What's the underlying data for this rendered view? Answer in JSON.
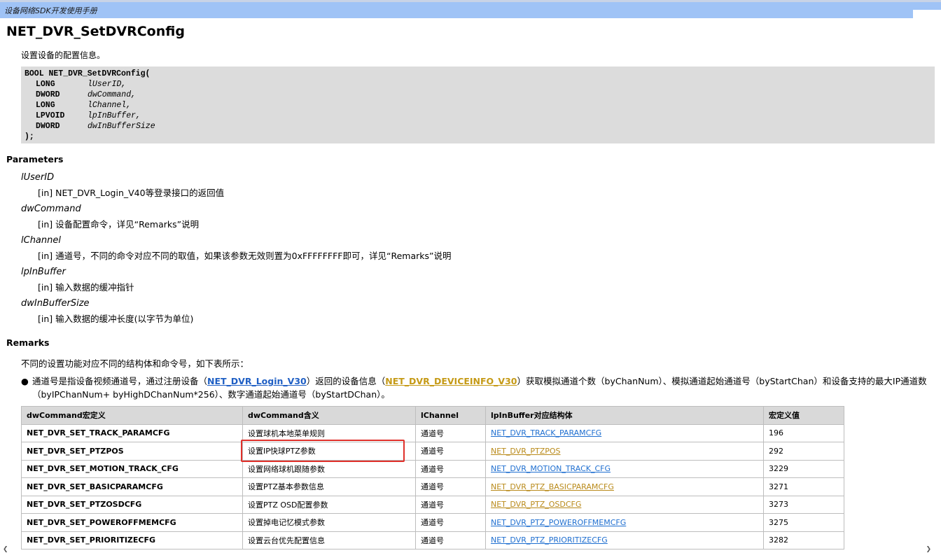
{
  "header": {
    "title": "设备网络SDK开发使用手册"
  },
  "page": {
    "title": "NET_DVR_SetDVRConfig",
    "description": "设置设备的配置信息。"
  },
  "code": {
    "line1": "BOOL NET_DVR_SetDVRConfig(",
    "params": [
      {
        "type": "LONG",
        "name": "lUserID,"
      },
      {
        "type": "DWORD",
        "name": "dwCommand,"
      },
      {
        "type": "LONG",
        "name": "lChannel,"
      },
      {
        "type": "LPVOID",
        "name": "lpInBuffer,"
      },
      {
        "type": "DWORD",
        "name": "dwInBufferSize"
      }
    ],
    "end": ");"
  },
  "parameters": {
    "heading": "Parameters",
    "items": [
      {
        "name": "lUserID",
        "desc": "[in] NET_DVR_Login_V40等登录接口的返回值"
      },
      {
        "name": "dwCommand",
        "desc": "[in] 设备配置命令，详见“Remarks”说明"
      },
      {
        "name": "lChannel",
        "desc": "[in] 通道号，不同的命令对应不同的取值，如果该参数无效则置为0xFFFFFFFF即可，详见“Remarks”说明"
      },
      {
        "name": "lpInBuffer",
        "desc": "[in] 输入数据的缓冲指针"
      },
      {
        "name": "dwInBufferSize",
        "desc": "[in] 输入数据的缓冲长度(以字节为单位)"
      }
    ]
  },
  "remarks": {
    "heading": "Remarks",
    "intro": "不同的设置功能对应不同的结构体和命令号，如下表所示：",
    "bullet": {
      "t1": "通道号是指设备视频通道号，通过注册设备（",
      "link1": "NET_DVR_Login_V30",
      "t2": "）返回的设备信息（",
      "link2": "NET_DVR_DEVICEINFO_V30",
      "t3": "）获取模拟通道个数（byChanNum）、模拟通道起始通道号（byStartChan）和设备支持的最大IP通道数（byIPChanNum+ byHighDChanNum*256）、数字通道起始通道号（byStartDChan）。"
    }
  },
  "table": {
    "headers": [
      "dwCommand宏定义",
      "dwCommand含义",
      "lChannel",
      "lpInBuffer对应结构体",
      "宏定义值"
    ],
    "rows": [
      {
        "cmd": "NET_DVR_SET_TRACK_PARAMCFG",
        "meaning": "设置球机本地菜单规则",
        "channel": "通道号",
        "struct": "NET_DVR_TRACK_PARAMCFG",
        "link_color": "blue",
        "value": "196"
      },
      {
        "cmd": "NET_DVR_SET_PTZPOS",
        "meaning": "设置IP快球PTZ参数",
        "channel": "通道号",
        "struct": "NET_DVR_PTZPOS",
        "link_color": "gold",
        "value": "292"
      },
      {
        "cmd": "NET_DVR_SET_MOTION_TRACK_CFG",
        "meaning": "设置网络球机跟随参数",
        "channel": "通道号",
        "struct": "NET_DVR_MOTION_TRACK_CFG",
        "link_color": "blue",
        "value": "3229"
      },
      {
        "cmd": "NET_DVR_SET_BASICPARAMCFG",
        "meaning": "设置PTZ基本参数信息",
        "channel": "通道号",
        "struct": "NET_DVR_PTZ_BASICPARAMCFG",
        "link_color": "gold",
        "value": "3271"
      },
      {
        "cmd": "NET_DVR_SET_PTZOSDCFG",
        "meaning": "设置PTZ OSD配置参数",
        "channel": "通道号",
        "struct": "NET_DVR_PTZ_OSDCFG",
        "link_color": "gold",
        "value": "3273"
      },
      {
        "cmd": "NET_DVR_SET_POWEROFFMEMCFG",
        "meaning": "设置掉电记忆模式参数",
        "channel": "通道号",
        "struct": "NET_DVR_PTZ_POWEROFFMEMCFG",
        "link_color": "blue",
        "value": "3275"
      },
      {
        "cmd": "NET_DVR_SET_PRIORITIZECFG",
        "meaning": "设置云台优先配置信息",
        "channel": "通道号",
        "struct": "NET_DVR_PTZ_PRIORITIZECFG",
        "link_color": "blue",
        "value": "3282"
      }
    ]
  },
  "colors": {
    "header_bar": "#9fc3f6",
    "link_blue": "#1f6fd0",
    "link_gold": "#b98a1a",
    "highlight": "#e0302a"
  }
}
